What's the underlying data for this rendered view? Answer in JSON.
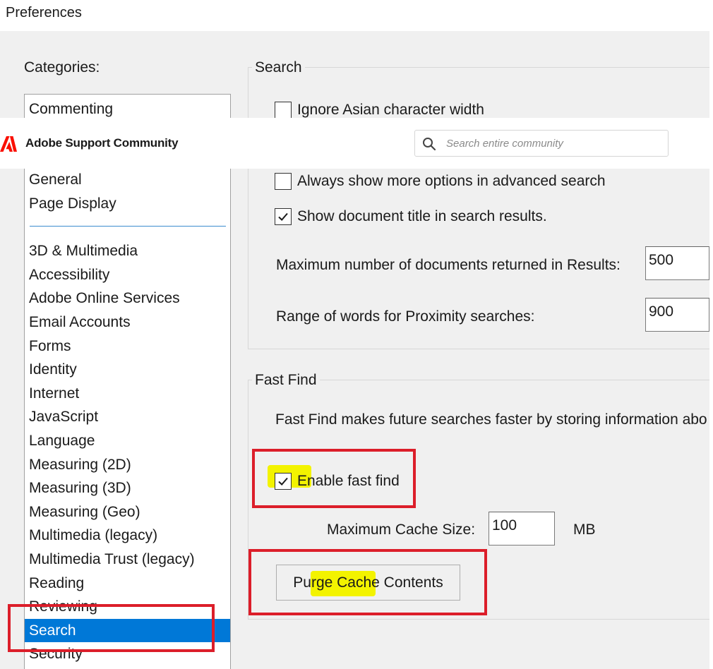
{
  "window": {
    "title": "Preferences"
  },
  "categories": {
    "label": "Categories:",
    "top_items": [
      "Commenting",
      "General",
      "Page Display"
    ],
    "items": [
      "3D & Multimedia",
      "Accessibility",
      "Adobe Online Services",
      "Email Accounts",
      "Forms",
      "Identity",
      "Internet",
      "JavaScript",
      "Language",
      "Measuring (2D)",
      "Measuring (3D)",
      "Measuring (Geo)",
      "Multimedia (legacy)",
      "Multimedia Trust (legacy)",
      "Reading",
      "Reviewing",
      "Search",
      "Security"
    ],
    "selected": "Search"
  },
  "search_group": {
    "title": "Search",
    "ignore_asian": {
      "label": "Ignore Asian character width",
      "checked": false
    },
    "always_show": {
      "label": "Always show more options in advanced search",
      "checked": false
    },
    "show_title": {
      "label": "Show document title in search results.",
      "checked": true
    },
    "max_docs": {
      "label": "Maximum number of documents returned in Results:",
      "value": "500"
    },
    "proximity": {
      "label": "Range of words for Proximity searches:",
      "value": "900"
    }
  },
  "fast_find": {
    "title": "Fast Find",
    "description": "Fast Find makes future searches faster by storing information abo",
    "enable": {
      "label": "Enable fast find",
      "checked": true
    },
    "cache_size": {
      "label": "Maximum Cache Size:",
      "value": "100",
      "unit": "MB"
    },
    "purge_button": "Purge Cache Contents"
  },
  "banner": {
    "title": "Adobe Support Community",
    "search_placeholder": "Search entire community",
    "brand_color": "#fa0f00"
  },
  "annotation_color": "#dc1e2a",
  "highlight_color": "#f3f300"
}
